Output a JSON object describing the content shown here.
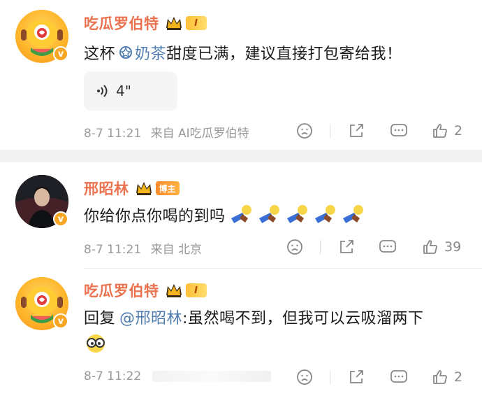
{
  "comments": [
    {
      "username": "吃瓜罗伯特",
      "level": "I",
      "text_prefix": "这杯",
      "topic": "奶茶",
      "text_suffix": "甜度已满，建议直接打包寄给我！",
      "voice_duration": "4\"",
      "time": "8-7 11:21",
      "source": "来自 AI吃瓜罗伯特",
      "likes": "2"
    },
    {
      "username": "邢昭林",
      "badge": "博主",
      "text": "你给你点你喝的到吗",
      "time": "8-7 11:21",
      "source": "来自 北京",
      "likes": "39"
    },
    {
      "username": "吃瓜罗伯特",
      "level": "I",
      "reply_prefix": "回复",
      "mention": "@邢昭林",
      "reply_text": ":虽然喝不到，但我可以云吸溜两下",
      "time": "8-7 11:22",
      "likes": "2"
    }
  ],
  "colors": {
    "username": "#eb7350",
    "link": "#507daf",
    "meta": "#999999"
  },
  "icons": [
    "crown-icon",
    "verified-icon",
    "topic-icon",
    "voice-icon",
    "sad-face-icon",
    "share-icon",
    "comment-icon",
    "like-icon",
    "cheers-emoji",
    "glasses-emoji"
  ]
}
